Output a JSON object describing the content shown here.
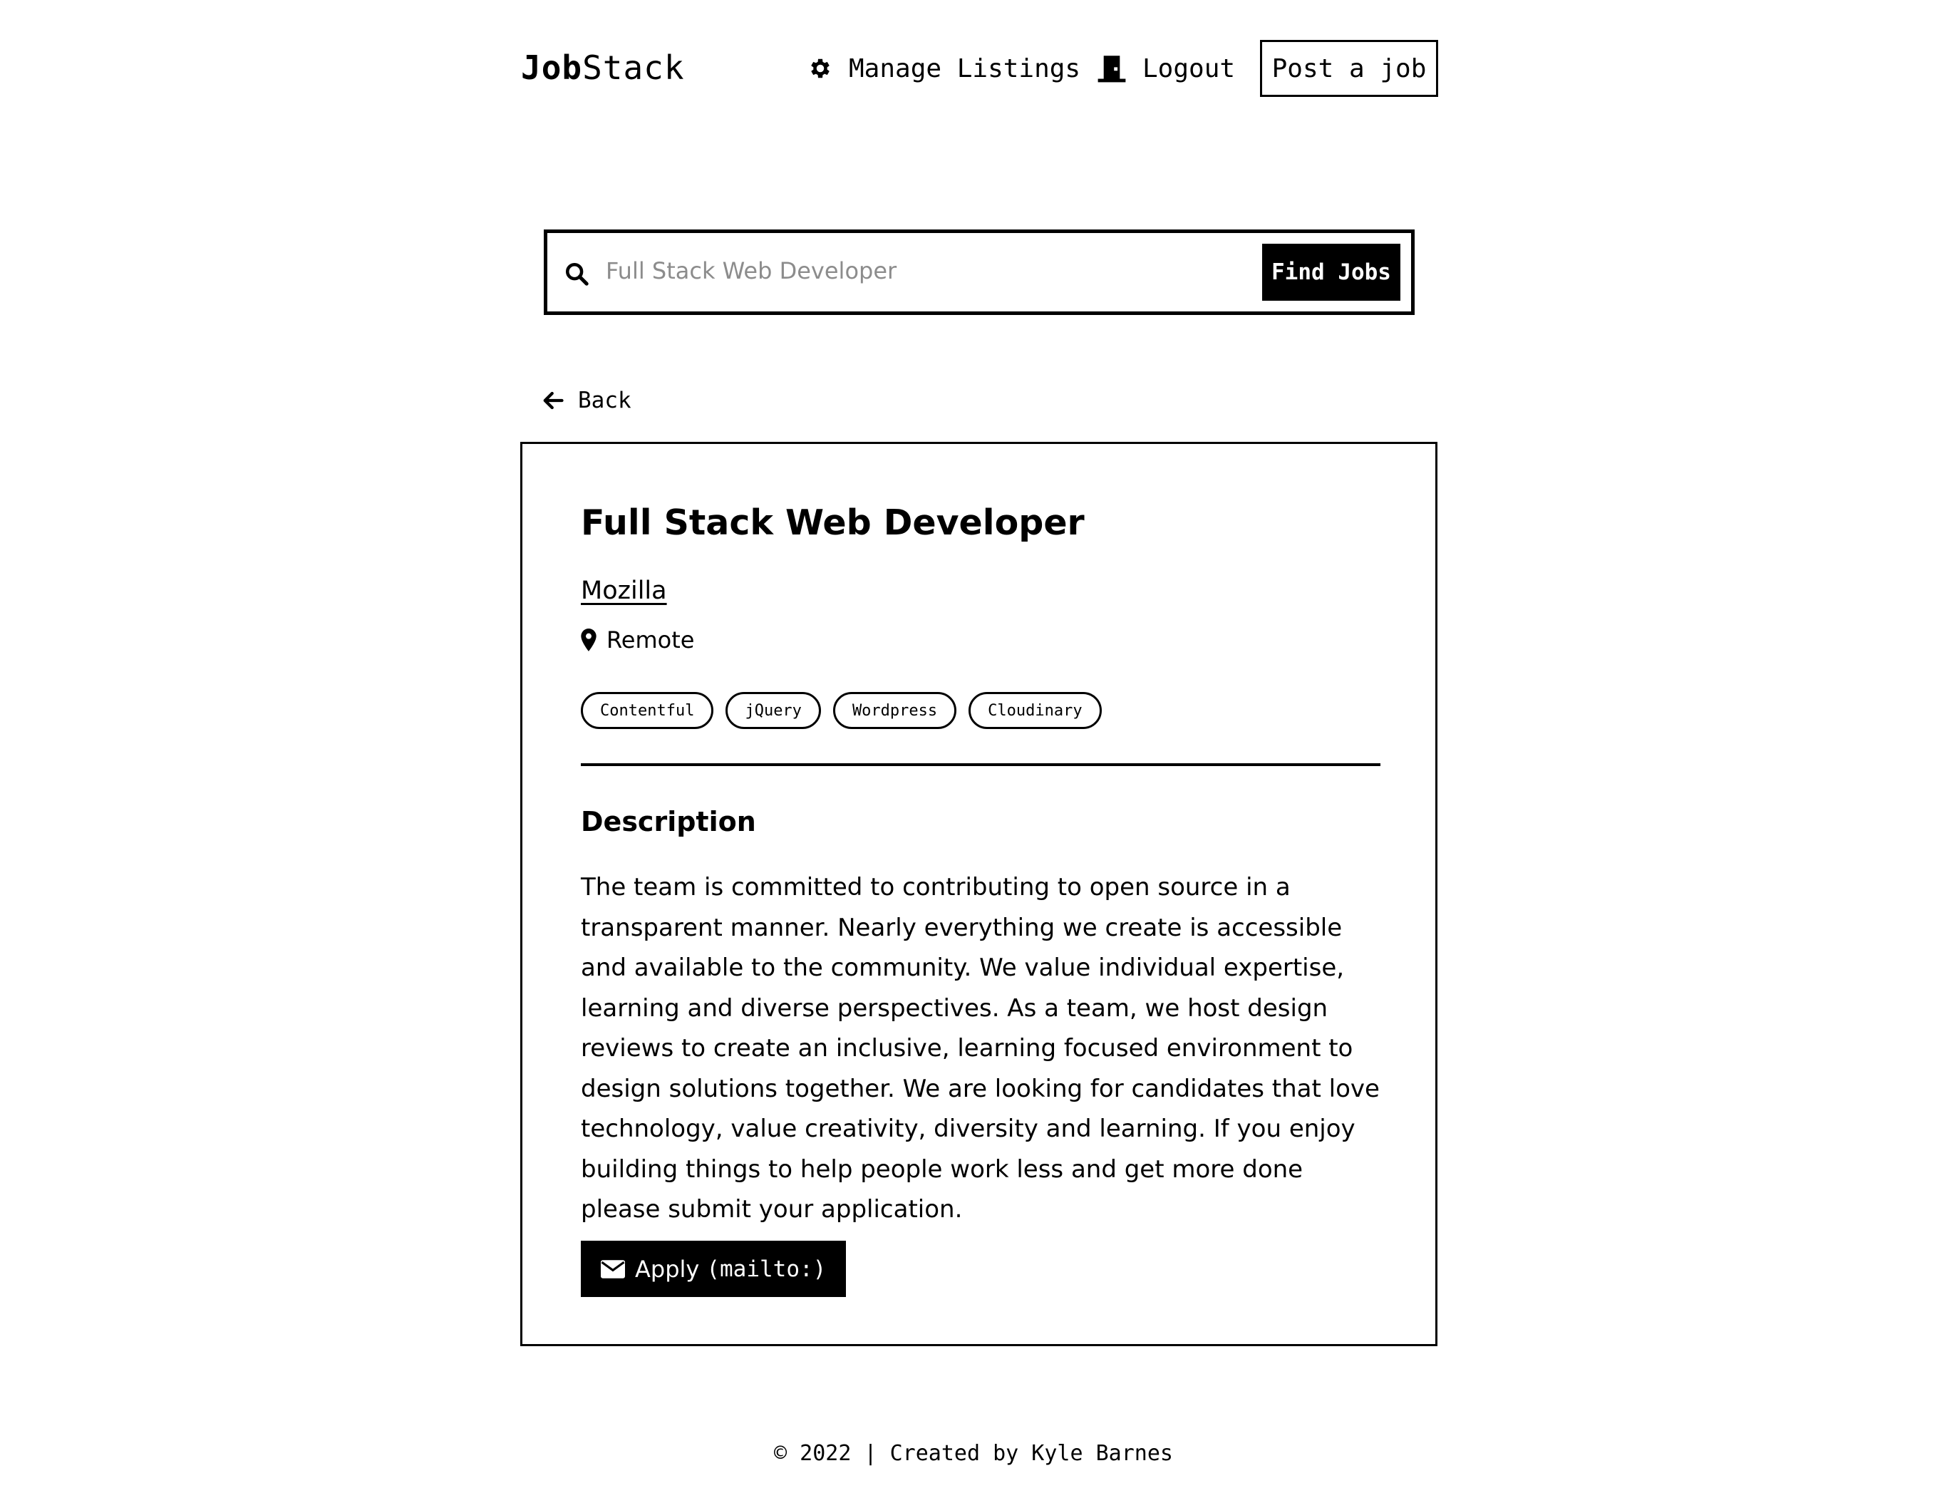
{
  "header": {
    "logo_bold": "Job",
    "logo_rest": "Stack",
    "manage_label": "Manage Listings",
    "logout_label": "Logout",
    "post_label": "Post a job"
  },
  "search": {
    "placeholder": "Full Stack Web Developer",
    "button_label": "Find Jobs"
  },
  "back_label": "Back",
  "job": {
    "title": "Full Stack Web Developer",
    "company": "Mozilla",
    "location": "Remote",
    "tags": [
      "Contentful",
      "jQuery",
      "Wordpress",
      "Cloudinary"
    ],
    "description_heading": "Description",
    "description": "The team is committed to contributing to open source in a transparent manner. Nearly everything we create is accessible and available to the community. We value individual expertise, learning and diverse perspectives. As a team, we host design reviews to create an inclusive, learning focused environment to design solutions together. We are looking for candidates that love technology, value creativity, diversity and learning. If you enjoy building things to help people work less and get more done please submit your application.",
    "apply_label": "Apply",
    "apply_code": "(mailto:)"
  },
  "footer": "© 2022 | Created by Kyle Barnes"
}
